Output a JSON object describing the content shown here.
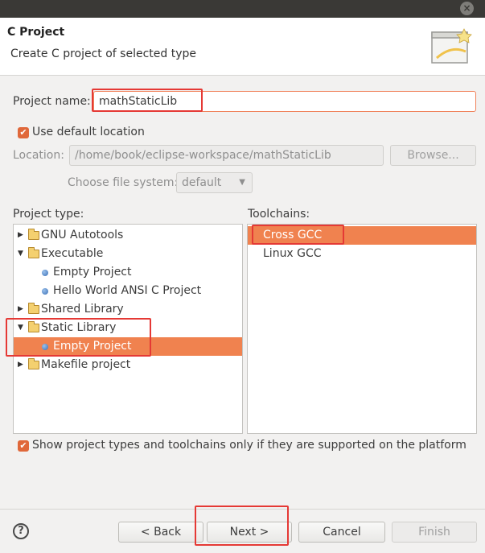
{
  "window": {
    "close_glyph": "×"
  },
  "header": {
    "title": "C Project",
    "description": "Create C project of selected type"
  },
  "form": {
    "project_name_label": "Project name:",
    "project_name_value": "mathStaticLib",
    "use_default_location_label": "Use default location",
    "use_default_location_checked": true,
    "location_label": "Location:",
    "location_value": "/home/book/eclipse-workspace/mathStaticLib",
    "browse_label": "Browse...",
    "file_system_label": "Choose file system:",
    "file_system_value": "default"
  },
  "project_type": {
    "label": "Project type:",
    "items": [
      {
        "label": "GNU Autotools",
        "kind": "folder",
        "expanded": false,
        "level": 0
      },
      {
        "label": "Executable",
        "kind": "folder",
        "expanded": true,
        "level": 0
      },
      {
        "label": "Empty Project",
        "kind": "leaf",
        "level": 1
      },
      {
        "label": "Hello World ANSI C Project",
        "kind": "leaf",
        "level": 1
      },
      {
        "label": "Shared Library",
        "kind": "folder",
        "expanded": false,
        "level": 0
      },
      {
        "label": "Static Library",
        "kind": "folder",
        "expanded": true,
        "level": 0
      },
      {
        "label": "Empty Project",
        "kind": "leaf",
        "level": 1,
        "selected": true
      },
      {
        "label": "Makefile project",
        "kind": "folder",
        "expanded": false,
        "level": 0
      }
    ]
  },
  "toolchains": {
    "label": "Toolchains:",
    "items": [
      {
        "label": "Cross GCC",
        "selected": true
      },
      {
        "label": "Linux GCC"
      }
    ]
  },
  "filter_checkbox_label": "Show project types and toolchains only if they are supported on the platform",
  "filter_checked": true,
  "footer": {
    "help_glyph": "?",
    "back_label": "< Back",
    "next_label": "Next >",
    "cancel_label": "Cancel",
    "finish_label": "Finish"
  },
  "colors": {
    "selection": "#f0824f",
    "annotation_red": "#e53935",
    "checkbox": "#e0683a"
  }
}
